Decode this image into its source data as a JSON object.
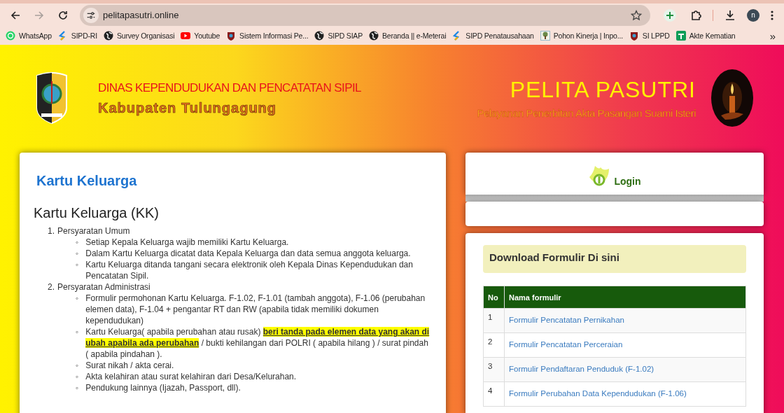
{
  "browser": {
    "back_disabled": false,
    "forward_disabled": true,
    "url": "pelitapasutri.online",
    "bookmarked": false,
    "profile_initial": "n",
    "bookmarks_overflow": "»",
    "bookmarks": [
      {
        "label": "WhatsApp",
        "kind": "whatsapp"
      },
      {
        "label": "SIPD-RI",
        "kind": "sipd"
      },
      {
        "label": "Survey Organisasi",
        "kind": "globe"
      },
      {
        "label": "Youtube",
        "kind": "youtube"
      },
      {
        "label": "Sistem Informasi Pe...",
        "kind": "emblem"
      },
      {
        "label": "SIPD SIAP",
        "kind": "globe"
      },
      {
        "label": "Beranda || e-Meterai",
        "kind": "globe"
      },
      {
        "label": "SIPD Penatausahaan",
        "kind": "sipd"
      },
      {
        "label": "Pohon Kinerja | Inpo...",
        "kind": "tree"
      },
      {
        "label": "SI LPPD",
        "kind": "emblem"
      },
      {
        "label": "Akte Kematian",
        "kind": "sheet"
      }
    ]
  },
  "banner": {
    "agency": "DINAS KEPENDUDUKAN DAN PENCATATAN SIPIL",
    "regency": "Kabupaten Tulungagung",
    "app_name": "PELITA PASUTRI",
    "app_tagline": "Pelayanan Penerbitan Akta Pasangan Suami Isteri"
  },
  "article": {
    "title": "Kartu Keluarga",
    "heading": "Kartu Keluarga (KK)",
    "sections": [
      {
        "number": "1.",
        "label": "Persyaratan Umum",
        "items": [
          {
            "marker": "◦",
            "text": "Setiap Kepala Keluarga wajib memiliki Kartu Keluarga."
          },
          {
            "marker": "◦",
            "text": "Dalam Kartu Keluarga dicatat data Kepala Keluarga dan data semua anggota keluarga."
          },
          {
            "marker": "◦",
            "text": "Kartu Keluarga ditanda tangani secara elektronik oleh Kepala Dinas Kependudukan dan Pencatatan Sipil."
          }
        ]
      },
      {
        "number": "2.",
        "label": "Persyaratan Administrasi",
        "items": [
          {
            "marker": "◦",
            "text": "Formulir permohonan Kartu Keluarga. F-1.02, F-1.01 (tambah anggota), F-1.06 (perubahan elemen data), F-1.04 + pengantar RT dan RW (apabila tidak memiliki dokumen kependudukan)"
          },
          {
            "marker": "◦",
            "text": "Kartu Keluarga( apabila perubahan atau rusak) **beri tanda pada elemen data yang akan di ubah apabila ada perubahan** / bukti kehilangan dari POLRI ( apabila hilang ) / surat pindah ( apabila pindahan )."
          },
          {
            "marker": "◦",
            "text": "Surat nikah / akta cerai."
          },
          {
            "marker": "◦",
            "text": "Akta kelahiran atau surat kelahiran dari Desa/Kelurahan."
          },
          {
            "marker": "◦",
            "text": "Pendukung lainnya (Ijazah, Passport, dll)."
          }
        ]
      }
    ]
  },
  "login": {
    "label": "Login"
  },
  "downloads": {
    "title": "Download Formulir Di sini",
    "columns": [
      "No",
      "Nama formulir"
    ],
    "rows": [
      {
        "no": "1",
        "name": "Formulir Pencatatan Pernikahan"
      },
      {
        "no": "2",
        "name": "Formulir Pencatatan Perceraian"
      },
      {
        "no": "3",
        "name": "Formulir Pendaftaran Penduduk (F-1.02)"
      },
      {
        "no": "4",
        "name": "Formulir Perubahan Data Kependudukan (F-1.06)"
      }
    ]
  }
}
